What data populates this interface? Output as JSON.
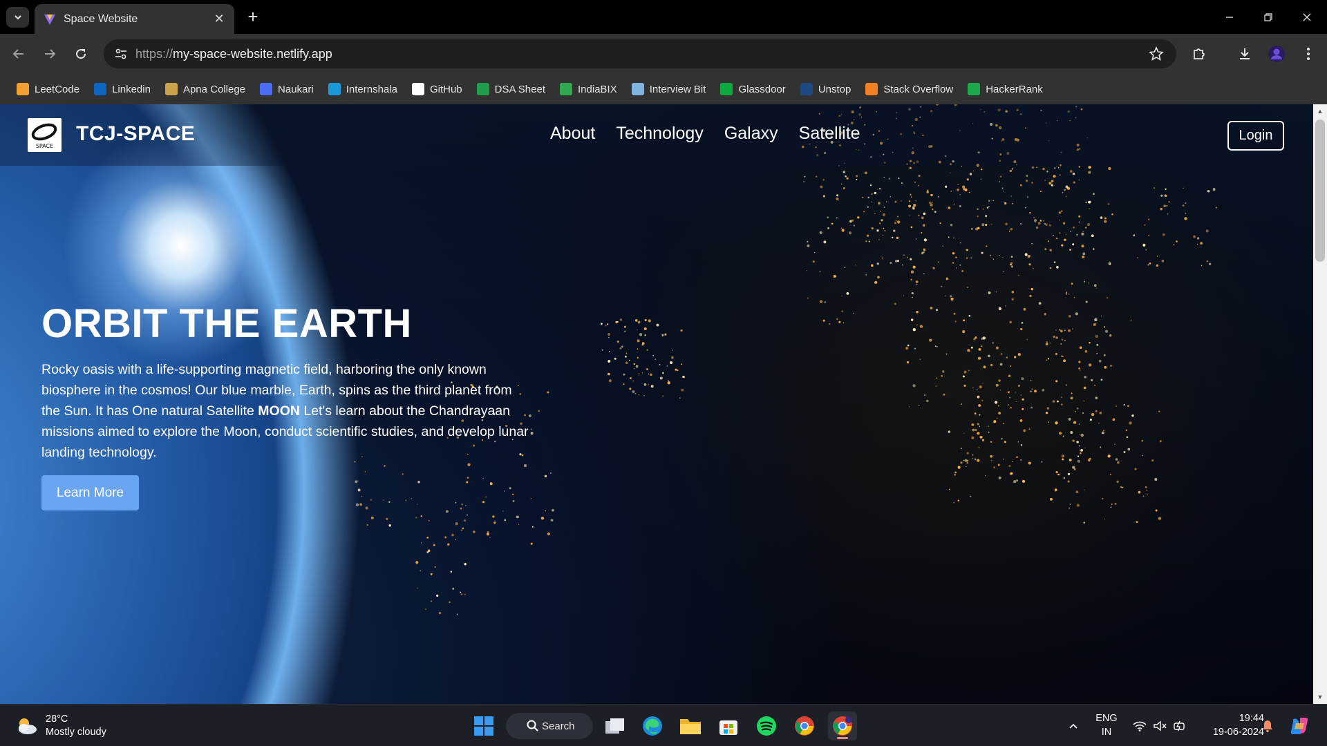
{
  "browser": {
    "tab_title": "Space Website",
    "url_protocol": "https://",
    "url_host": "my-space-website.netlify.app",
    "bookmarks": [
      {
        "label": "LeetCode",
        "icon": "leetcode-icon",
        "color": "#f0a030"
      },
      {
        "label": "Linkedin",
        "icon": "linkedin-icon",
        "color": "#0a66c2"
      },
      {
        "label": "Apna College",
        "icon": "apna-college-icon",
        "color": "#c9a24a"
      },
      {
        "label": "Naukari",
        "icon": "naukari-icon",
        "color": "#4a6cf7"
      },
      {
        "label": "Internshala",
        "icon": "internshala-icon",
        "color": "#1a9ad8"
      },
      {
        "label": "GitHub",
        "icon": "github-icon",
        "color": "#ffffff"
      },
      {
        "label": "DSA Sheet",
        "icon": "dsa-sheet-icon",
        "color": "#1e9e4a"
      },
      {
        "label": "IndiaBIX",
        "icon": "indiabix-icon",
        "color": "#2fa84f"
      },
      {
        "label": "Interview Bit",
        "icon": "interviewbit-icon",
        "color": "#7fb3e0"
      },
      {
        "label": "Glassdoor",
        "icon": "glassdoor-icon",
        "color": "#0caa41"
      },
      {
        "label": "Unstop",
        "icon": "unstop-icon",
        "color": "#1c4980"
      },
      {
        "label": "Stack Overflow",
        "icon": "stackoverflow-icon",
        "color": "#f48024"
      },
      {
        "label": "HackerRank",
        "icon": "hackerrank-icon",
        "color": "#1ba94c"
      }
    ]
  },
  "site": {
    "logo_text": "SPACE",
    "brand": "TCJ-SPACE",
    "nav": [
      "About",
      "Technology",
      "Galaxy",
      "Satellite"
    ],
    "login": "Login",
    "hero_title": "ORBIT THE EARTH",
    "hero_text_1": "Rocky oasis with a life-supporting magnetic field, harboring the only known biosphere in the cosmos! Our blue marble, Earth, spins as the third planet from the Sun. It has One natural Satellite ",
    "hero_text_bold": "MOON",
    "hero_text_2": " Let's learn about the Chandrayaan missions aimed to explore the Moon, conduct scientific studies, and develop lunar landing technology.",
    "cta": "Learn More",
    "cta_color": "#6aa5f2"
  },
  "taskbar": {
    "weather_temp": "28°C",
    "weather_desc": "Mostly cloudy",
    "search_label": "Search",
    "lang_1": "ENG",
    "lang_2": "IN",
    "time": "19:44",
    "date": "19-06-2024"
  }
}
